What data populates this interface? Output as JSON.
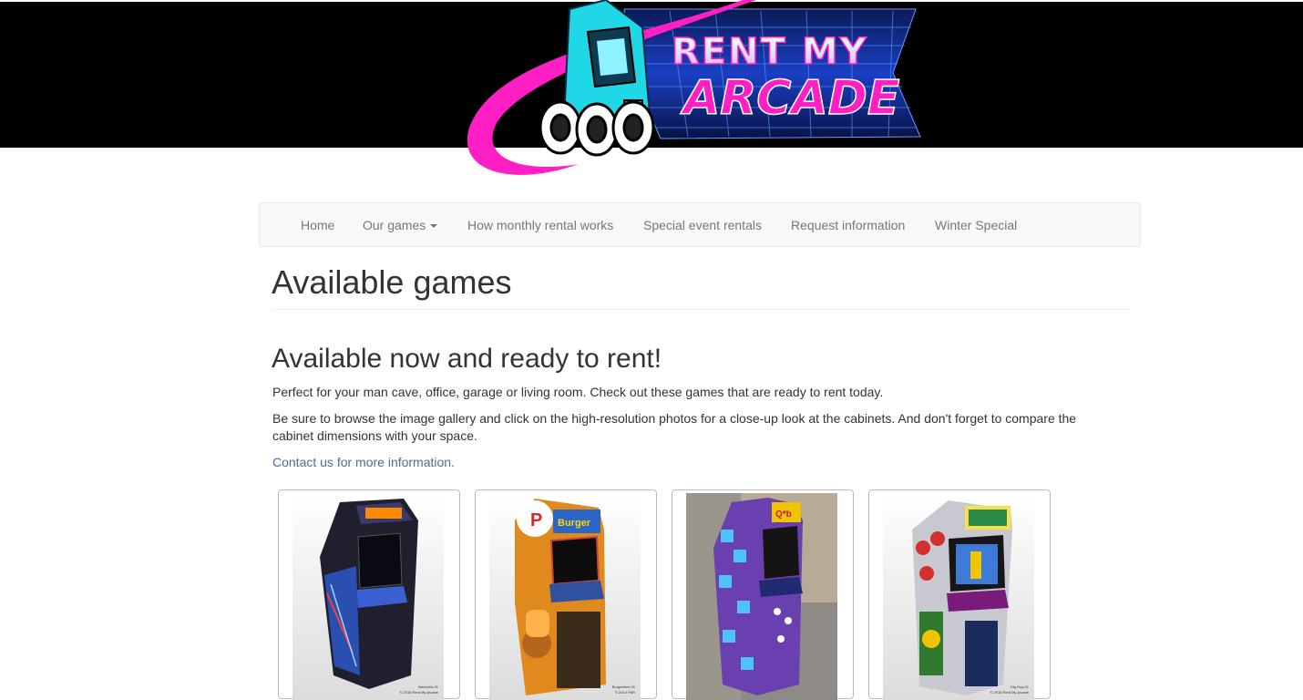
{
  "logo": {
    "line1": "RENT MY",
    "line2": "ARCADE",
    "colors": {
      "pink": "#ff1fc4",
      "blue": "#1b6cff",
      "cyan": "#1fd7e6"
    }
  },
  "nav": {
    "items": [
      {
        "label": "Home"
      },
      {
        "label": "Our games",
        "has_dropdown": true
      },
      {
        "label": "How monthly rental works"
      },
      {
        "label": "Special event rentals"
      },
      {
        "label": "Request information"
      },
      {
        "label": "Winter Special"
      }
    ]
  },
  "content": {
    "page_title": "Available games",
    "subtitle": "Available now and ready to rent!",
    "paragraph1": "Perfect for your man cave, office, garage or living room. Check out these games that are ready to rent today.",
    "paragraph2": "Be sure to browse the image gallery and click on the high-resolution photos for a close-up look at the cabinets. And don't forget to compare the cabinet dimensions with your space.",
    "contact_link": "Contact us for more information."
  },
  "gallery": [
    {
      "game": "Asteroids",
      "caption_line1": "Asteroids 01",
      "caption_line2": "© 2016 Rent My Arcade",
      "primary_color": "#1f1f2e"
    },
    {
      "game": "BurgerTime",
      "caption_line1": "Burgertime 01",
      "caption_line2": "© 2014 PAR",
      "primary_color": "#e08a1e"
    },
    {
      "game": "Q*bert",
      "caption_line1": "",
      "caption_line2": "",
      "primary_color": "#6a3fb0"
    },
    {
      "game": "Dig Dug",
      "caption_line1": "Dig Dug 01",
      "caption_line2": "© 2016 Rent My Arcade",
      "primary_color": "#c8c8d0"
    }
  ]
}
